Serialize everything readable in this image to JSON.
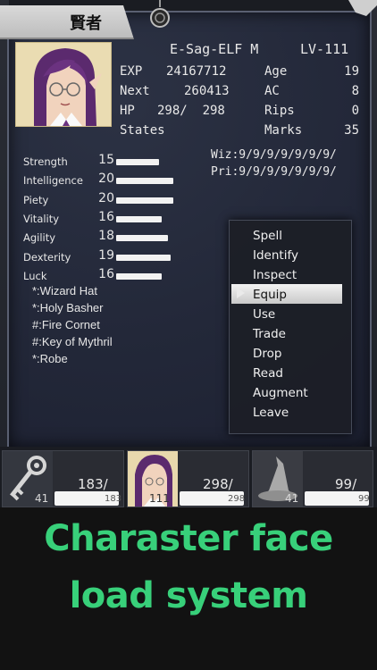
{
  "header": {
    "class_kanji": "賢者"
  },
  "character": {
    "name": "E-Sag-ELF M",
    "level": "LV-111",
    "rows": [
      {
        "label": "EXP",
        "value": "24167712",
        "label2": "Age",
        "value2": "19"
      },
      {
        "label": "Next",
        "value": "260413",
        "label2": "AC",
        "value2": "8"
      },
      {
        "label": "HP",
        "value": "298/  298",
        "label2": "Rips",
        "value2": "0"
      },
      {
        "label": "States",
        "value": "",
        "label2": "Marks",
        "value2": "35"
      }
    ],
    "spells": {
      "wiz": "Wiz:9/9/9/9/9/9/9/",
      "pri": "Pri:9/9/9/9/9/9/9/"
    }
  },
  "stats": [
    {
      "label": "Strength",
      "value": "15",
      "fill": 0.75
    },
    {
      "label": "Intelligence",
      "value": "20",
      "fill": 1.0
    },
    {
      "label": "Piety",
      "value": "20",
      "fill": 1.0
    },
    {
      "label": "Vitality",
      "value": "16",
      "fill": 0.8
    },
    {
      "label": "Agility",
      "value": "18",
      "fill": 0.9
    },
    {
      "label": "Dexterity",
      "value": "19",
      "fill": 0.95
    },
    {
      "label": "Luck",
      "value": "16",
      "fill": 0.8
    }
  ],
  "equipment": [
    "*:Wizard Hat",
    "*:Holy Basher",
    "#:Fire Cornet",
    "#:Key of Mythril",
    "*:Robe"
  ],
  "menu": {
    "items": [
      "Spell",
      "Identify",
      "Inspect",
      "Equip",
      "Use",
      "Trade",
      "Drop",
      "Read",
      "Augment",
      "Leave"
    ],
    "selected": "Equip"
  },
  "party": [
    {
      "icon": "key-icon",
      "level": "41",
      "hp": "183/",
      "max": "183",
      "fill": 1.0
    },
    {
      "icon": "portrait-icon",
      "level": "111",
      "hp": "298/",
      "max": "298",
      "fill": 1.0
    },
    {
      "icon": "wizard-hat-icon",
      "level": "41",
      "hp": "99/",
      "max": "99",
      "fill": 1.0
    }
  ],
  "promo": {
    "line1": "Charaster face",
    "line2": "load system",
    "color": "#38d07a"
  }
}
